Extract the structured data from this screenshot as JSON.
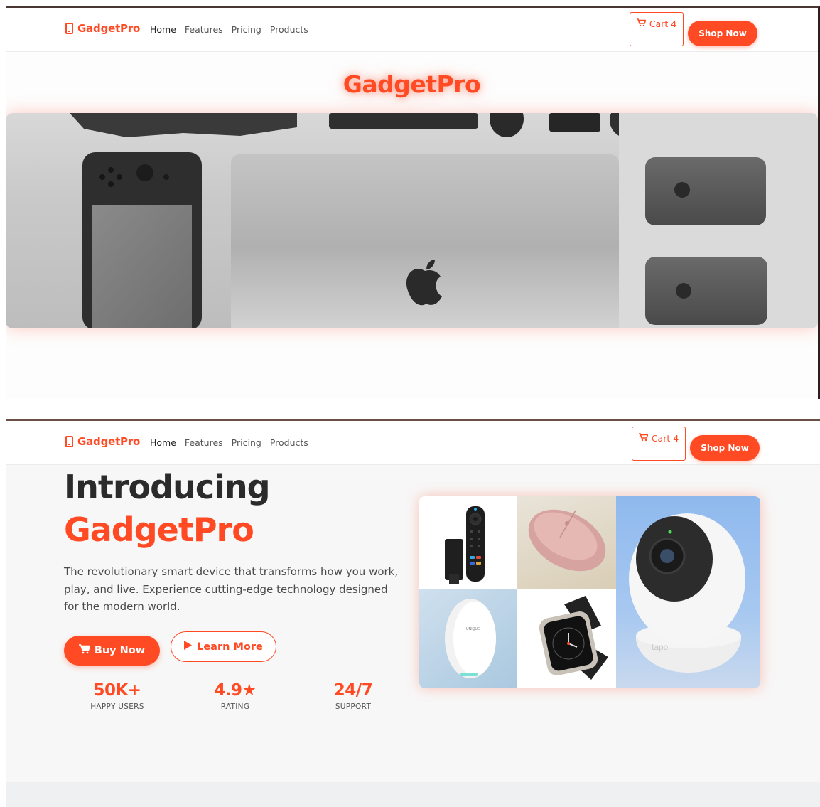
{
  "nav": {
    "brand": "GadgetPro",
    "links": [
      "Home",
      "Features",
      "Pricing",
      "Products"
    ],
    "cart_label": "Cart 4",
    "shop_label": "Shop Now"
  },
  "hero1": {
    "title": "GadgetPro"
  },
  "hero2": {
    "heading_line1": "Introducing",
    "heading_line2": "GadgetPro",
    "description": "The revolutionary smart device that transforms how you work, play, and live. Experience cutting-edge technology designed for the modern world.",
    "buy_label": "Buy Now",
    "learn_label": "Learn More",
    "stats": [
      {
        "value": "50K+",
        "label": "HAPPY USERS"
      },
      {
        "value": "4.9★",
        "label": "RATING"
      },
      {
        "value": "24/7",
        "label": "SUPPORT"
      }
    ]
  },
  "product_labels": {
    "hub_brand": "UNIQUE",
    "camera_brand": "tapo"
  },
  "colors": {
    "accent": "#ff4a24",
    "heading": "#2b2b2b"
  },
  "icons": {
    "brand": "phone-icon",
    "cart": "cart-icon",
    "buy": "cart-icon",
    "learn": "play-icon"
  }
}
